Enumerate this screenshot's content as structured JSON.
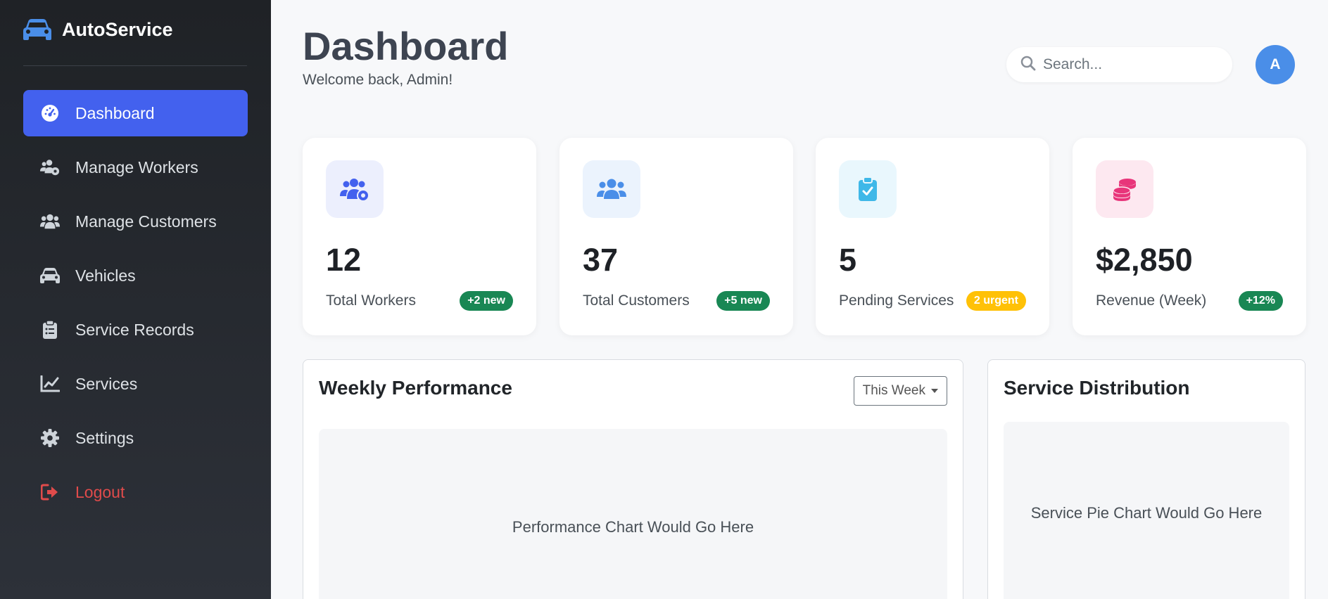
{
  "brand": {
    "name": "AutoService"
  },
  "sidebar": {
    "items": [
      {
        "label": "Dashboard",
        "icon": "gauge-icon",
        "active": true
      },
      {
        "label": "Manage Workers",
        "icon": "users-gear-icon"
      },
      {
        "label": "Manage Customers",
        "icon": "users-icon"
      },
      {
        "label": "Vehicles",
        "icon": "car-icon"
      },
      {
        "label": "Service Records",
        "icon": "clipboard-list-icon"
      },
      {
        "label": "Services",
        "icon": "line-chart-icon"
      },
      {
        "label": "Settings",
        "icon": "gear-icon"
      },
      {
        "label": "Logout",
        "icon": "logout-icon"
      }
    ]
  },
  "header": {
    "title": "Dashboard",
    "subtitle": "Welcome back, Admin!",
    "search_placeholder": "Search...",
    "avatar_initial": "A"
  },
  "stats": [
    {
      "value": "12",
      "label": "Total Workers",
      "badge": "+2 new",
      "badge_color": "#198754",
      "icon": "users-gear-icon",
      "icon_color": "#4361ee",
      "icon_bg": "#eceffd"
    },
    {
      "value": "37",
      "label": "Total Customers",
      "badge": "+5 new",
      "badge_color": "#198754",
      "icon": "users-icon",
      "icon_color": "#4a8ee8",
      "icon_bg": "#ebf3fd"
    },
    {
      "value": "5",
      "label": "Pending Services",
      "badge": "2 urgent",
      "badge_color": "#ffc107",
      "icon": "clipboard-check-icon",
      "icon_color": "#3fb8e8",
      "icon_bg": "#e9f7fd"
    },
    {
      "value": "$2,850",
      "label": "Revenue (Week)",
      "badge": "+12%",
      "badge_color": "#198754",
      "icon": "coins-icon",
      "icon_color": "#e8357a",
      "icon_bg": "#fde8f0"
    }
  ],
  "panels": {
    "performance": {
      "title": "Weekly Performance",
      "dropdown_value": "This Week",
      "placeholder": "Performance Chart Would Go Here"
    },
    "distribution": {
      "title": "Service Distribution",
      "placeholder": "Service Pie Chart Would Go Here"
    }
  },
  "colors": {
    "accent": "#4361ee",
    "sidebar_bg": "#25292f",
    "logout": "#e04b4b"
  }
}
